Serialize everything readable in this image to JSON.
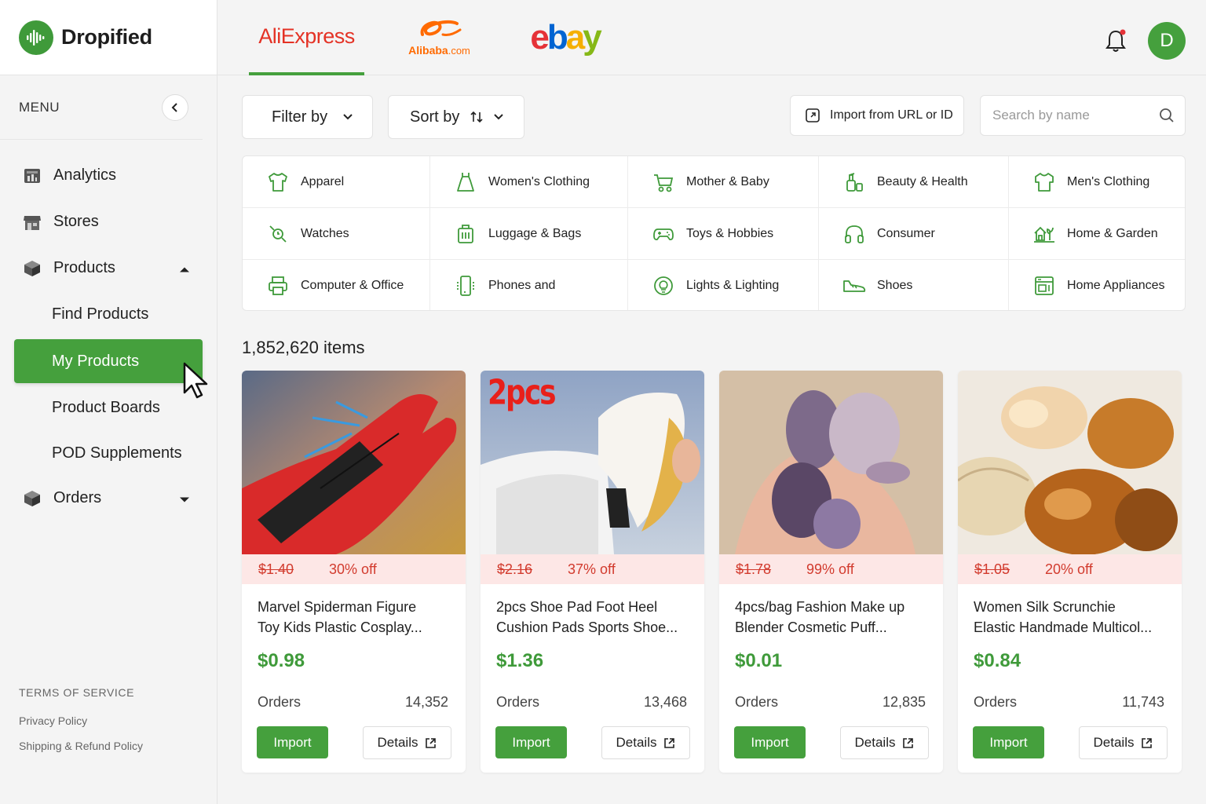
{
  "brand": {
    "name": "Dropified"
  },
  "marketplaces": [
    {
      "label": "AliExpress"
    },
    {
      "label": "Alibaba",
      "suffix": ".com"
    },
    {
      "label": "ebay"
    }
  ],
  "user": {
    "initial": "D"
  },
  "sidebar": {
    "menu_label": "MENU",
    "items": [
      {
        "label": "Analytics",
        "icon": "analytics-icon"
      },
      {
        "label": "Stores",
        "icon": "store-icon"
      },
      {
        "label": "Products",
        "icon": "box-icon",
        "expanded": true
      },
      {
        "label": "Orders",
        "icon": "box-icon",
        "expanded": false
      }
    ],
    "product_subitems": [
      {
        "label": "Find Products"
      },
      {
        "label": "My Products",
        "active": true
      },
      {
        "label": "Product Boards"
      },
      {
        "label": "POD Supplements"
      }
    ],
    "footer": {
      "terms": "TERMS OF SERVICE",
      "privacy": "Privacy Policy",
      "shipping": "Shipping & Refund Policy"
    }
  },
  "toolbar": {
    "filter_label": "Filter by",
    "sort_label": "Sort by",
    "import_label": "Import from URL or ID",
    "search_placeholder": "Search by name"
  },
  "categories": [
    {
      "label": "Apparel",
      "icon": "shirt-icon"
    },
    {
      "label": "Women's Clothing",
      "icon": "dress-icon"
    },
    {
      "label": "Mother & Baby",
      "icon": "stroller-icon"
    },
    {
      "label": "Beauty & Health",
      "icon": "cosmetics-icon"
    },
    {
      "label": "Men's Clothing",
      "icon": "tshirt-icon"
    },
    {
      "label": "Watches",
      "icon": "watch-icon"
    },
    {
      "label": "Luggage & Bags",
      "icon": "luggage-icon"
    },
    {
      "label": "Toys & Hobbies",
      "icon": "gamepad-icon"
    },
    {
      "label": "Consumer",
      "icon": "headphones-icon"
    },
    {
      "label": "Home & Garden",
      "icon": "home-garden-icon"
    },
    {
      "label": "Computer & Office",
      "icon": "printer-icon"
    },
    {
      "label": "Phones and",
      "icon": "phone-icon"
    },
    {
      "label": "Lights & Lighting",
      "icon": "bulb-icon"
    },
    {
      "label": "Shoes",
      "icon": "shoe-icon"
    },
    {
      "label": "Home Appliances",
      "icon": "appliance-icon"
    }
  ],
  "results": {
    "count_text": "1,852,620 items"
  },
  "products": [
    {
      "old_price": "$1.40",
      "discount": "30% off",
      "title_line1": "Marvel Spiderman Figure",
      "title_line2": "Toy Kids Plastic Cosplay...",
      "price": "$0.98",
      "orders_label": "Orders",
      "orders": "14,352",
      "import_label": "Import",
      "details_label": "Details"
    },
    {
      "old_price": "$2.16",
      "discount": "37% off",
      "title_line1": "2pcs Shoe Pad Foot Heel",
      "title_line2": "Cushion Pads Sports Shoe...",
      "price": "$1.36",
      "orders_label": "Orders",
      "orders": "13,468",
      "import_label": "Import",
      "details_label": "Details",
      "image_text": "2pcs"
    },
    {
      "old_price": "$1.78",
      "discount": "99% off",
      "title_line1": "4pcs/bag Fashion Make up",
      "title_line2": "Blender Cosmetic Puff...",
      "price": "$0.01",
      "orders_label": "Orders",
      "orders": "12,835",
      "import_label": "Import",
      "details_label": "Details"
    },
    {
      "old_price": "$1.05",
      "discount": "20% off",
      "title_line1": "Women Silk Scrunchie",
      "title_line2": "Elastic Handmade Multicol...",
      "price": "$0.84",
      "orders_label": "Orders",
      "orders": "11,743",
      "import_label": "Import",
      "details_label": "Details"
    }
  ],
  "colors": {
    "accent": "#45a03d",
    "discount_bg": "#fde7e6",
    "discount_text": "#d23b2e"
  }
}
